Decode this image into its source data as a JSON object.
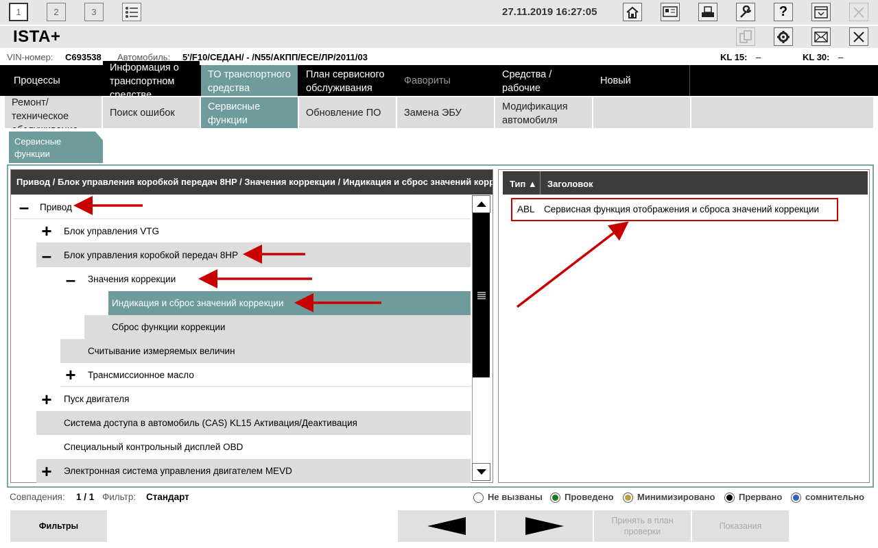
{
  "topbar": {
    "tabs": [
      "1",
      "2",
      "3"
    ],
    "datetime": "27.11.2019 16:27:05"
  },
  "app": {
    "title": "ISTA+"
  },
  "vehicle": {
    "vin_label": "VIN-номер:",
    "vin_value": "C693538",
    "car_label": "Автомобиль:",
    "car_value": "5'/F10/СЕДАН/ - /N55/АКПП/ЕСЕ/ЛР/2011/03",
    "kl15_label": "KL 15:",
    "kl15_value": "–",
    "kl30_label": "KL 30:",
    "kl30_value": "–"
  },
  "nav_row1": [
    {
      "label": "Процессы"
    },
    {
      "label": "Информация о транспортном средстве"
    },
    {
      "label": "ТО транспортного средства"
    },
    {
      "label": "План сервисного обслуживания"
    },
    {
      "label": "Фавориты"
    },
    {
      "label": "Средства / рабочие жидкости"
    },
    {
      "label": "Новый"
    }
  ],
  "nav_row2": [
    {
      "label": "Ремонт/ техническое обслуживание"
    },
    {
      "label": "Поиск ошибок"
    },
    {
      "label": "Сервисные функции"
    },
    {
      "label": "Обновление ПО"
    },
    {
      "label": "Замена ЭБУ"
    },
    {
      "label": "Модификация автомобиля"
    }
  ],
  "subtab": {
    "label": "Сервисные функции"
  },
  "tree": {
    "breadcrumb": "Привод / Блок управления коробкой передач 8HP / Значения коррекции / Индикация и сброс значений коррекции",
    "items": [
      {
        "label": "Привод",
        "toggle": "–"
      },
      {
        "label": "Блок управления VTG",
        "toggle": "+"
      },
      {
        "label": "Блок управления коробкой передач 8HP",
        "toggle": "–"
      },
      {
        "label": "Значения коррекции",
        "toggle": "–"
      },
      {
        "label": "Индикация и сброс значений коррекции",
        "toggle": ""
      },
      {
        "label": "Сброс функции коррекции",
        "toggle": ""
      },
      {
        "label": "Считывание измеряемых величин",
        "toggle": ""
      },
      {
        "label": "Трансмиссионное масло",
        "toggle": "+"
      },
      {
        "label": "Пуск двигателя",
        "toggle": "+"
      },
      {
        "label": "Система доступа в автомобиль (CAS) KL15 Активация/Деактивация",
        "toggle": ""
      },
      {
        "label": "Специальный контрольный дисплей OBD",
        "toggle": ""
      },
      {
        "label": "Электронная система управления двигателем MEVD",
        "toggle": "+"
      }
    ]
  },
  "results": {
    "col_type": "Тип ▲",
    "col_title": "Заголовок",
    "rows": [
      {
        "type": "ABL",
        "title": "Сервисная функция отображения и сброса значений коррекции"
      }
    ]
  },
  "status": {
    "matches_label": "Совпадения:",
    "matches_value": "1 / 1",
    "filter_label": "Фильтр:",
    "filter_value": "Стандарт"
  },
  "legend": [
    {
      "label": "Не вызваны",
      "color": "#ffffff"
    },
    {
      "label": "Проведено",
      "color": "#1a7a1a"
    },
    {
      "label": "Минимизировано",
      "color": "#b8a040"
    },
    {
      "label": "Прервано",
      "color": "#000000"
    },
    {
      "label": "сомнительно",
      "color": "#3060c0"
    }
  ],
  "buttons": {
    "filters": "Фильтры",
    "add_plan": "Принять в план проверки",
    "show": "Показания"
  },
  "colors": {
    "accent": "#6e9b9b",
    "header_dark": "#3c3c3c",
    "annotation_red": "#c80000"
  }
}
